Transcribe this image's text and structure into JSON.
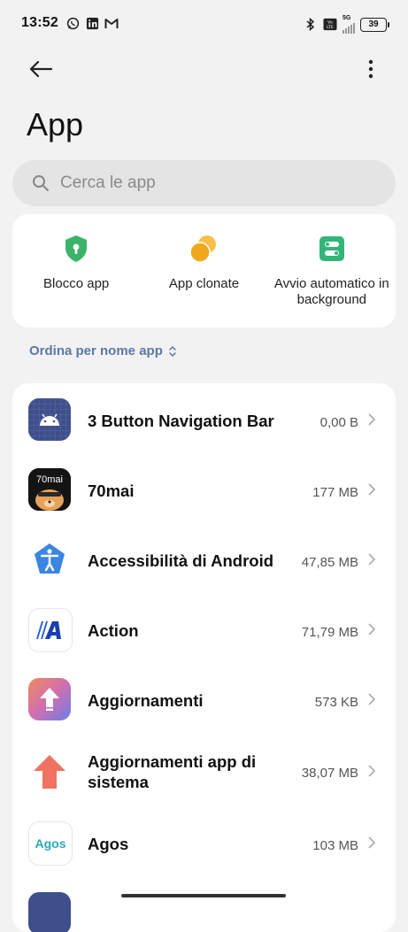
{
  "status_bar": {
    "time": "13:52",
    "left_icons": [
      "whatsapp-icon",
      "linkedin-icon",
      "gmail-icon"
    ],
    "right_icons": [
      "bluetooth-icon",
      "volte-icon",
      "5g-signal-icon"
    ],
    "network": "5G",
    "battery": "39"
  },
  "header": {
    "title": "App"
  },
  "search": {
    "placeholder": "Cerca le app"
  },
  "shortcuts": [
    {
      "label": "Blocco app",
      "icon": "shield-lock-icon",
      "color": "#3bb36a"
    },
    {
      "label": "App clonate",
      "icon": "clone-circles-icon",
      "color": "#f2a81d"
    },
    {
      "label": "Avvio automatico in background",
      "icon": "toggle-icon",
      "color": "#33b57a"
    }
  ],
  "sort": {
    "label": "Ordina per nome app"
  },
  "apps": [
    {
      "name": "3 Button Navigation Bar",
      "size": "0,00 B"
    },
    {
      "name": "70mai",
      "size": "177 MB"
    },
    {
      "name": "Accessibilità di Android",
      "size": "47,85 MB"
    },
    {
      "name": "Action",
      "size": "71,79 MB"
    },
    {
      "name": "Aggiornamenti",
      "size": "573 KB"
    },
    {
      "name": "Aggiornamenti app di sistema",
      "size": "38,07 MB"
    },
    {
      "name": "Agos",
      "size": "103 MB"
    }
  ],
  "app_icon_texts": {
    "seventymai": "70mai",
    "agos": "Agos"
  }
}
